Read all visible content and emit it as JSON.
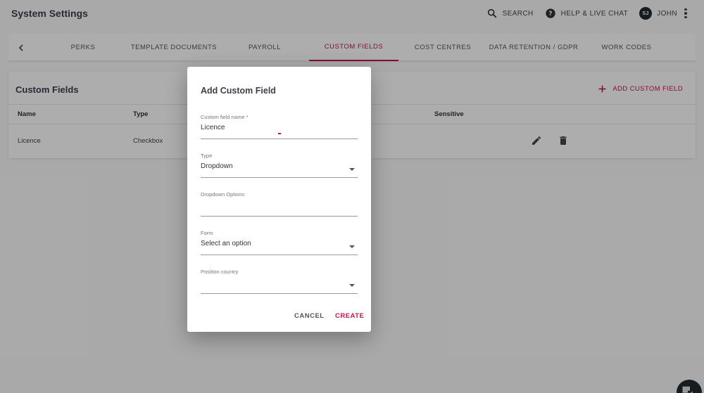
{
  "header": {
    "title": "System Settings",
    "search_label": "SEARCH",
    "help_label": "HELP & LIVE CHAT",
    "user_initials": "SJ",
    "user_name": "JOHN"
  },
  "tabs": [
    {
      "label": "PERKS"
    },
    {
      "label": "TEMPLATE DOCUMENTS"
    },
    {
      "label": "PAYROLL"
    },
    {
      "label": "CUSTOM FIELDS",
      "active": true
    },
    {
      "label": "COST CENTRES"
    },
    {
      "label": "DATA RETENTION / GDPR"
    },
    {
      "label": "WORK CODES"
    }
  ],
  "custom_fields": {
    "title": "Custom Fields",
    "add_label": "ADD CUSTOM FIELD",
    "columns": {
      "name": "Name",
      "type": "Type",
      "sensitive": "Sensitive"
    },
    "rows": [
      {
        "name": "Licence",
        "type": "Checkbox"
      }
    ]
  },
  "dialog": {
    "title": "Add Custom Field",
    "name_field": {
      "label": "Custom field name *",
      "value": "Licence"
    },
    "type_field": {
      "label": "Type",
      "value": "Dropdown"
    },
    "options_field": {
      "label": "Dropdown Options",
      "value": ""
    },
    "form_field": {
      "label": "Form",
      "value": "Select an option"
    },
    "country_field": {
      "label": "Position country",
      "value": ""
    },
    "cancel_label": "CANCEL",
    "create_label": "CREATE"
  },
  "colors": {
    "accent": "#c1164a",
    "dark": "#1f2a33",
    "overlay": "rgba(0,0,0,0.32)"
  }
}
